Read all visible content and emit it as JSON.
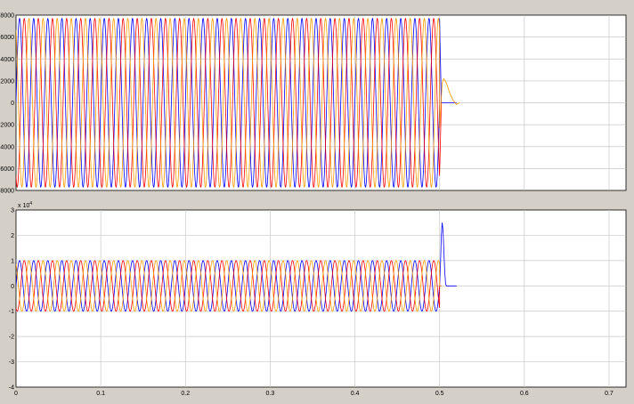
{
  "chart_data": [
    {
      "type": "line",
      "title": "",
      "xlabel": "",
      "ylabel": "",
      "xlim": [
        0,
        0.72
      ],
      "ylim": [
        -8000,
        8000
      ],
      "grid": true,
      "xticks": [
        "0",
        "0.1",
        "0.2",
        "0.3",
        "0.4",
        "0.5",
        "0.6",
        "0.7"
      ],
      "yticks": [
        "-8000",
        "-6000",
        "-4000",
        "-2000",
        "0",
        "2000",
        "4000",
        "6000",
        "8000"
      ],
      "signal": {
        "amplitude": 7700,
        "frequency_hz": 60,
        "phase_shift_deg": [
          0,
          -120,
          120
        ],
        "t_start": 0,
        "t_cutoff": 0.5,
        "t_end": 0.52
      },
      "series": [
        {
          "color": "#0000ff",
          "after_cutoff": {
            "t": [
              0.5,
              0.502,
              0.52
            ],
            "y": [
              7700,
              0,
              0
            ]
          }
        },
        {
          "color": "#ff0000",
          "after_cutoff": {
            "t": [
              0.5,
              0.502
            ],
            "y": [
              -6600,
              0
            ]
          }
        },
        {
          "color": "#ff9900",
          "after_cutoff": {
            "t": [
              0.5,
              0.503,
              0.505,
              0.508,
              0.512,
              0.516,
              0.52,
              0.523
            ],
            "y": [
              -2300,
              1800,
              2200,
              1800,
              900,
              200,
              -150,
              0
            ]
          }
        }
      ]
    },
    {
      "type": "line",
      "title": "",
      "xlabel": "",
      "ylabel": "",
      "exponent_label": "x 10",
      "exponent_power": "4",
      "xlim": [
        0,
        0.72
      ],
      "ylim": [
        -4,
        3
      ],
      "grid": true,
      "xticks": [
        "0",
        "0.1",
        "0.2",
        "0.3",
        "0.4",
        "0.5",
        "0.6",
        "0.7"
      ],
      "yticks": [
        "-4",
        "-3",
        "-2",
        "-1",
        "0",
        "1",
        "2",
        "3"
      ],
      "signal": {
        "amplitude": 1,
        "frequency_hz": 60,
        "phase_shift_deg": [
          0,
          -120,
          120
        ],
        "t_start": 0,
        "t_cutoff": 0.5,
        "t_end": 0.52
      },
      "series": [
        {
          "color": "#0000ff",
          "after_cutoff": {
            "t": [
              0.5,
              0.501,
              0.502,
              0.503,
              0.504,
              0.505,
              0.506,
              0.507,
              0.508,
              0.509,
              0.52
            ],
            "y": [
              0,
              0.8,
              2.0,
              2.5,
              2.2,
              1.4,
              0.6,
              0.1,
              0,
              0,
              0
            ]
          }
        },
        {
          "color": "#ff0000",
          "after_cutoff": {
            "t": [
              0.5,
              0.502
            ],
            "y": [
              0,
              0
            ]
          }
        },
        {
          "color": "#ff9900",
          "after_cutoff": {
            "t": [
              0.5,
              0.502
            ],
            "y": [
              0,
              0
            ]
          }
        }
      ]
    }
  ]
}
